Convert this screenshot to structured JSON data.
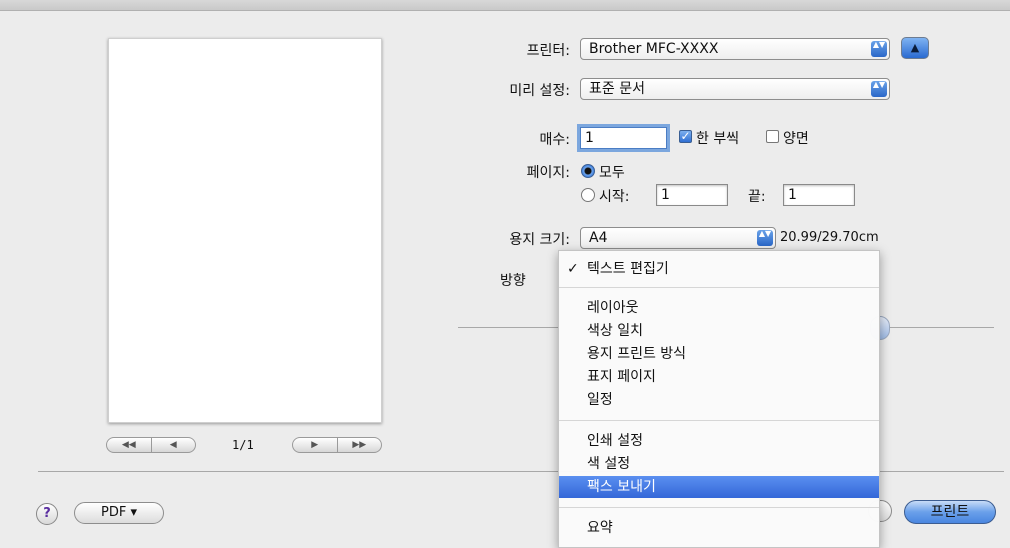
{
  "preview": {
    "page_indicator": "1/1",
    "first_btn": "◀◀",
    "prev_btn": "◀",
    "next_btn": "▶",
    "last_btn": "▶▶"
  },
  "printer": {
    "label": "프린터:",
    "value": "Brother MFC-XXXX"
  },
  "presets": {
    "label": "미리 설정:",
    "value": "표준 문서"
  },
  "copies": {
    "label": "매수:",
    "value": "1",
    "collated_label": "한 부씩",
    "collated": true,
    "duplex_label": "양면",
    "duplex": false
  },
  "pages": {
    "label": "페이지:",
    "all_label": "모두",
    "from_label": "시작:",
    "from_value": "1",
    "to_label": "끝:",
    "to_value": "1",
    "selected": "all"
  },
  "paper_size": {
    "label": "용지 크기:",
    "value": "A4",
    "dimensions": "20.99/29.70cm"
  },
  "orientation": {
    "label": "방향"
  },
  "menu": {
    "checkmark": "✓",
    "items_group1": [
      "텍스트 편집기"
    ],
    "items_group2": [
      "레이아웃",
      "색상 일치",
      "용지 프린트 방식",
      "표지 페이지",
      "일정"
    ],
    "items_group3": [
      "인쇄 설정",
      "색 설정",
      "팩스 보내기"
    ],
    "items_group4": [
      "요약"
    ],
    "selected_item": "팩스 보내기",
    "checked_item": "텍스트 편집기"
  },
  "footer": {
    "help": "?",
    "pdf_label": "PDF ▾",
    "print_label": "프린트"
  },
  "icons": {
    "disclosure": "▲",
    "stepper": "▲▼"
  },
  "colors": {
    "accent": "#3467d8",
    "background": "#ececec"
  }
}
